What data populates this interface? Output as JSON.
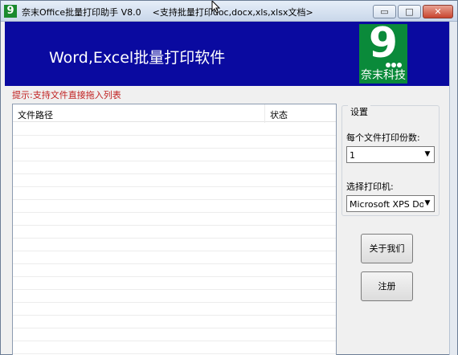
{
  "window": {
    "icon_char": "9",
    "title": "奈末Office批量打印助手 V8.0",
    "subtitle": "<支持批量打印doc,docx,xls,xlsx文档>",
    "controls": {
      "minimize": "▭",
      "maximize": "□",
      "close": "✕"
    }
  },
  "banner": {
    "headline": "Word,Excel批量打印软件",
    "logo_digit": "9",
    "logo_company": "奈末科技"
  },
  "hint": "提示:支持文件直接拖入列表",
  "file_list": {
    "columns": [
      "文件路径",
      "状态"
    ],
    "rows": []
  },
  "settings": {
    "group_title": "设置",
    "copies_label": "每个文件打印份数:",
    "copies_value": "1",
    "printer_label": "选择打印机:",
    "printer_value": "Microsoft XPS Doc"
  },
  "buttons": {
    "about": "关于我们",
    "register": "注册"
  },
  "colors": {
    "banner_bg": "#0a0aa0",
    "logo_bg": "#0a8a3a",
    "hint_text": "#c02020"
  }
}
